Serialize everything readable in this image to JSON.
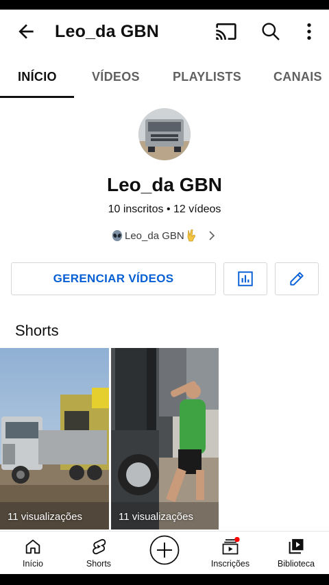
{
  "header": {
    "title": "Leo_da GBN",
    "icons": [
      "back-arrow-icon",
      "cast-icon",
      "search-icon",
      "more-vert-icon"
    ]
  },
  "tabs": [
    {
      "label": "INÍCIO",
      "active": true
    },
    {
      "label": "VÍDEOS",
      "active": false
    },
    {
      "label": "PLAYLISTS",
      "active": false
    },
    {
      "label": "CANAIS",
      "active": false
    }
  ],
  "channel": {
    "name": "Leo_da GBN",
    "stats": "10 inscritos • 12 vídeos",
    "link_text": "Leo_da GBN"
  },
  "actions": {
    "manage_label": "GERENCIAR VÍDEOS",
    "icons": [
      "analytics-icon",
      "edit-pencil-icon"
    ]
  },
  "shorts": {
    "title": "Shorts",
    "items": [
      {
        "views": "11 visualizações"
      },
      {
        "views": "11 visualizações"
      }
    ]
  },
  "bottom_nav": [
    {
      "label": "Início",
      "icon": "home-icon"
    },
    {
      "label": "Shorts",
      "icon": "shorts-icon"
    },
    {
      "label": "",
      "icon": "create-plus-icon"
    },
    {
      "label": "Inscrições",
      "icon": "subscriptions-icon",
      "badge": true
    },
    {
      "label": "Biblioteca",
      "icon": "library-icon"
    }
  ],
  "colors": {
    "accent_blue": "#065fd4",
    "text_primary": "#0f0f0f",
    "text_secondary": "#606060",
    "notification_red": "#ff0000"
  }
}
